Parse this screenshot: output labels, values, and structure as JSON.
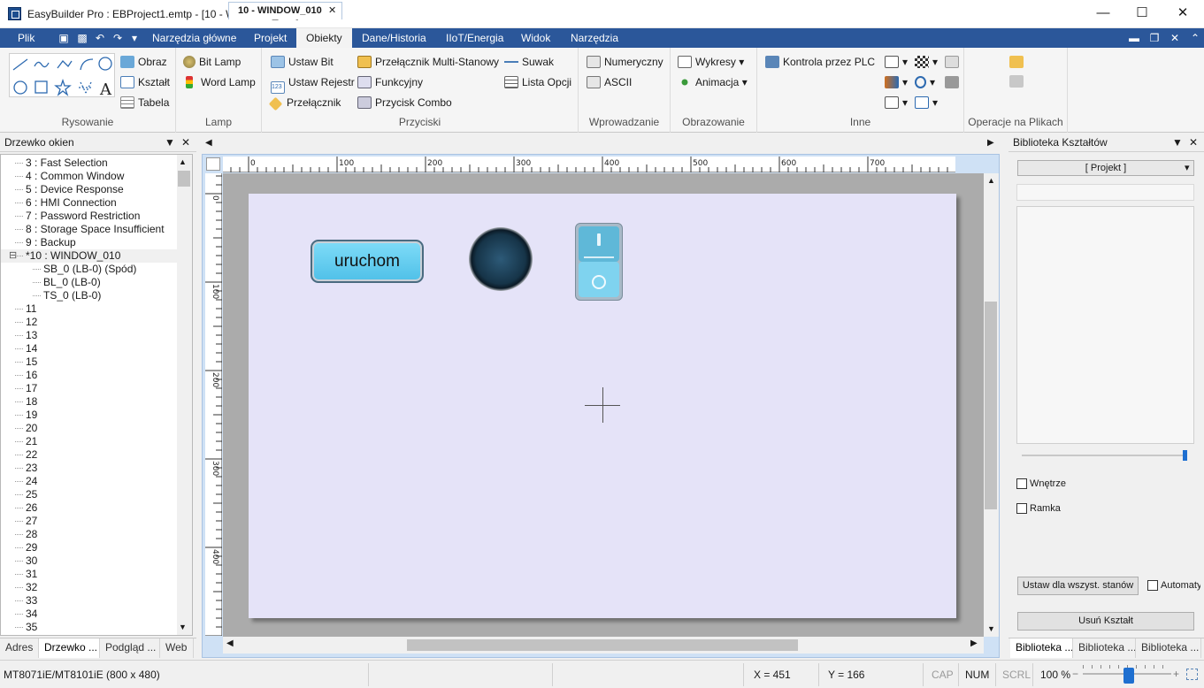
{
  "window": {
    "title": "EasyBuilder Pro : EBProject1.emtp - [10 - WINDOW_010]"
  },
  "ribbon_tabs": [
    "Plik",
    "Narzędzia główne",
    "Projekt",
    "Obiekty",
    "Dane/Historia",
    "IIoT/Energia",
    "Widok",
    "Narzędzia"
  ],
  "active_tab": "Obiekty",
  "groups": {
    "rysowanie": {
      "caption": "Rysowanie",
      "items": [
        "Obraz",
        "Kształt",
        "Tabela"
      ],
      "draw_letter": "A"
    },
    "lamp": {
      "caption": "Lamp",
      "items": [
        "Bit Lamp",
        "Word Lamp"
      ]
    },
    "przyciski": {
      "caption": "Przyciski",
      "col1": [
        "Ustaw Bit",
        "Ustaw Rejestr",
        "Przełącznik"
      ],
      "col2": [
        "Przełącznik Multi-Stanowy",
        "Funkcyjny",
        "Przycisk Combo"
      ],
      "col3": [
        "Suwak",
        "Lista Opcji"
      ]
    },
    "wprowadzanie": {
      "caption": "Wprowadzanie",
      "items": [
        "Numeryczny",
        "ASCII"
      ]
    },
    "obrazowanie": {
      "caption": "Obrazowanie",
      "items": [
        "Wykresy",
        "Animacja"
      ]
    },
    "inne": {
      "caption": "Inne",
      "items": [
        "Kontrola przez PLC"
      ]
    },
    "pliki": {
      "caption": "Operacje na Plikach"
    }
  },
  "left_panel": {
    "title": "Drzewko okien",
    "items": [
      "3 : Fast Selection",
      "4 : Common Window",
      "5 : Device Response",
      "6 : HMI Connection",
      "7 : Password Restriction",
      "8 : Storage Space Insufficient",
      "9 : Backup",
      "*10 : WINDOW_010",
      "SB_0 (LB-0) (Spód)",
      "BL_0 (LB-0)",
      "TS_0 (LB-0)",
      "11",
      "12",
      "13",
      "14",
      "15",
      "16",
      "17",
      "18",
      "19",
      "20",
      "21",
      "22",
      "23",
      "24",
      "25",
      "26",
      "27",
      "28",
      "29",
      "30",
      "31",
      "32",
      "33",
      "34",
      "35"
    ],
    "tabs": [
      "Adres",
      "Drzewko ...",
      "Podgląd ...",
      "Web"
    ]
  },
  "doc_tab": "10 - WINDOW_010",
  "ruler_h": [
    "0",
    "100",
    "200",
    "300",
    "400",
    "500",
    "600",
    "700"
  ],
  "ruler_v": [
    "0",
    "100",
    "200",
    "300",
    "400"
  ],
  "canvas": {
    "button_label": "uruchom"
  },
  "right_panel": {
    "title": "Biblioteka Kształtów",
    "combo": "[ Projekt ]",
    "checkboxes": [
      "Wnętrze",
      "Ramka"
    ],
    "btn_apply": "Ustaw dla wszyst. stanów",
    "auto_label": "Automaty",
    "btn_remove": "Usuń Kształt",
    "tabs": [
      "Biblioteka ...",
      "Biblioteka ...",
      "Biblioteka ..."
    ]
  },
  "status": {
    "model": "MT8071iE/MT8101iE (800 x 480)",
    "x": "X = 451",
    "y": "Y = 166",
    "cap": "CAP",
    "num": "NUM",
    "scrl": "SCRL",
    "zoom": "100 %"
  }
}
